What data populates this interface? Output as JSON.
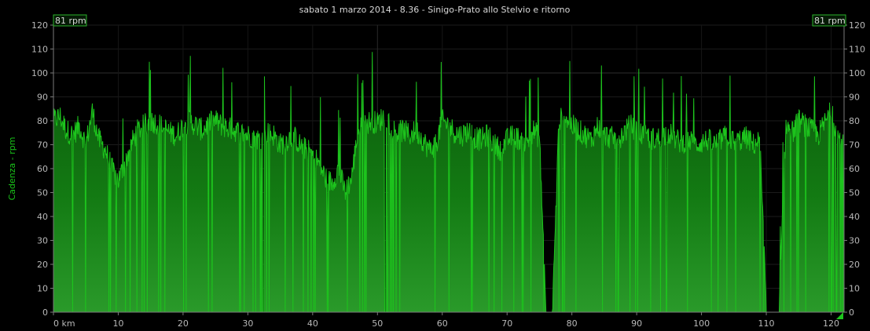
{
  "chart_data": {
    "type": "area",
    "title": "sabato 1 marzo 2014 - 8.36 - Sinigo-Prato allo Stelvio e ritorno",
    "ylabel": "Cadenza - rpm",
    "xlabel": "",
    "x_unit": "km",
    "ylim": [
      0,
      120
    ],
    "xlim": [
      0,
      122
    ],
    "yticks": [
      0,
      10,
      20,
      30,
      40,
      50,
      60,
      70,
      80,
      90,
      100,
      110,
      120
    ],
    "xticks": [
      0,
      10,
      20,
      30,
      40,
      50,
      60,
      70,
      80,
      90,
      100,
      110,
      120
    ],
    "xtick_labels": [
      "0 km",
      "10",
      "20",
      "30",
      "40",
      "50",
      "60",
      "70",
      "80",
      "90",
      "100",
      "110",
      "120"
    ],
    "grid": true,
    "badge_left": "81 rpm",
    "badge_right": "81 rpm",
    "line_color": "#1dc41d",
    "fill_top_color": "#0c6a0c",
    "fill_bottom_color": "#2f9e2f",
    "series": [
      {
        "x": [
          0,
          1,
          2,
          3,
          4,
          5,
          6,
          7,
          8,
          9,
          10,
          11,
          12,
          13,
          14,
          15,
          16,
          17,
          18,
          19,
          20,
          21,
          22,
          23,
          24,
          25,
          26,
          27,
          28,
          29,
          30,
          31,
          32,
          33,
          34,
          35,
          36,
          37,
          38,
          39,
          40,
          41,
          42,
          43,
          44,
          45,
          46,
          47,
          48,
          49,
          50,
          51,
          52,
          53,
          54,
          55,
          56,
          57,
          58,
          59,
          60,
          61,
          62,
          63,
          64,
          65,
          66,
          67,
          68,
          69,
          70,
          71,
          72,
          73,
          74,
          75,
          76,
          77,
          78,
          79,
          80,
          81,
          82,
          83,
          84,
          85,
          86,
          87,
          88,
          89,
          90,
          91,
          92,
          93,
          94,
          95,
          96,
          97,
          98,
          99,
          100,
          101,
          102,
          103,
          104,
          105,
          106,
          107,
          108,
          109,
          110,
          111,
          112,
          113,
          114,
          115,
          116,
          117,
          118,
          119,
          120,
          121,
          122
        ],
        "y": [
          80,
          82,
          76,
          74,
          78,
          70,
          84,
          72,
          68,
          60,
          55,
          62,
          70,
          76,
          78,
          80,
          79,
          77,
          75,
          74,
          78,
          80,
          78,
          76,
          79,
          80,
          78,
          77,
          76,
          75,
          74,
          73,
          72,
          75,
          74,
          70,
          72,
          74,
          70,
          68,
          66,
          62,
          56,
          54,
          60,
          50,
          56,
          76,
          78,
          80,
          79,
          82,
          78,
          75,
          76,
          74,
          76,
          72,
          68,
          70,
          80,
          78,
          75,
          74,
          76,
          73,
          72,
          74,
          70,
          68,
          72,
          74,
          72,
          70,
          76,
          73,
          0,
          0,
          80,
          82,
          78,
          76,
          74,
          72,
          78,
          74,
          73,
          72,
          75,
          78,
          76,
          74,
          73,
          72,
          74,
          75,
          72,
          71,
          72,
          70,
          71,
          72,
          70,
          72,
          74,
          71,
          72,
          73,
          70,
          72,
          0,
          0,
          0,
          78,
          75,
          80,
          78,
          76,
          74,
          79,
          84,
          74,
          70
        ]
      }
    ]
  }
}
